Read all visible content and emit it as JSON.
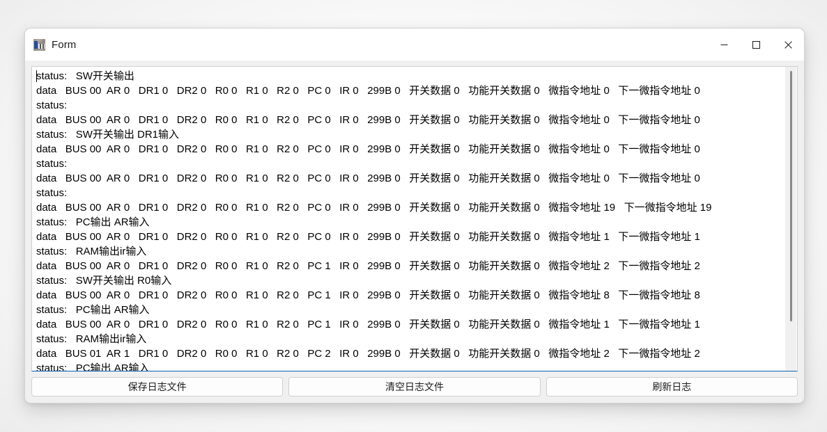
{
  "window": {
    "title": "Form",
    "icon": "app-form-icon",
    "controls": {
      "minimize": "─",
      "maximize": "□",
      "close": "✕"
    }
  },
  "log": {
    "lines": [
      "status:   SW开关输出",
      "data   BUS 00  AR 0   DR1 0   DR2 0   R0 0   R1 0   R2 0   PC 0   IR 0   299B 0   开关数据 0   功能开关数据 0   微指令地址 0   下一微指令地址 0",
      "status:",
      "data   BUS 00  AR 0   DR1 0   DR2 0   R0 0   R1 0   R2 0   PC 0   IR 0   299B 0   开关数据 0   功能开关数据 0   微指令地址 0   下一微指令地址 0",
      "status:   SW开关输出 DR1输入",
      "data   BUS 00  AR 0   DR1 0   DR2 0   R0 0   R1 0   R2 0   PC 0   IR 0   299B 0   开关数据 0   功能开关数据 0   微指令地址 0   下一微指令地址 0",
      "status:",
      "data   BUS 00  AR 0   DR1 0   DR2 0   R0 0   R1 0   R2 0   PC 0   IR 0   299B 0   开关数据 0   功能开关数据 0   微指令地址 0   下一微指令地址 0",
      "status:",
      "data   BUS 00  AR 0   DR1 0   DR2 0   R0 0   R1 0   R2 0   PC 0   IR 0   299B 0   开关数据 0   功能开关数据 0   微指令地址 19   下一微指令地址 19",
      "status:   PC输出 AR输入",
      "data   BUS 00  AR 0   DR1 0   DR2 0   R0 0   R1 0   R2 0   PC 0   IR 0   299B 0   开关数据 0   功能开关数据 0   微指令地址 1   下一微指令地址 1",
      "status:   RAM输出ir输入",
      "data   BUS 00  AR 0   DR1 0   DR2 0   R0 0   R1 0   R2 0   PC 1   IR 0   299B 0   开关数据 0   功能开关数据 0   微指令地址 2   下一微指令地址 2",
      "status:   SW开关输出 R0输入",
      "data   BUS 00  AR 0   DR1 0   DR2 0   R0 0   R1 0   R2 0   PC 1   IR 0   299B 0   开关数据 0   功能开关数据 0   微指令地址 8   下一微指令地址 8",
      "status:   PC输出 AR输入",
      "data   BUS 00  AR 0   DR1 0   DR2 0   R0 0   R1 0   R2 0   PC 1   IR 0   299B 0   开关数据 0   功能开关数据 0   微指令地址 1   下一微指令地址 1",
      "status:   RAM输出ir输入",
      "data   BUS 01  AR 1   DR1 0   DR2 0   R0 0   R1 0   R2 0   PC 2   IR 0   299B 0   开关数据 0   功能开关数据 0   微指令地址 2   下一微指令地址 2",
      "status:   PC输出 AR输入"
    ]
  },
  "buttons": {
    "save_log": "保存日志文件",
    "clear_log": "清空日志文件",
    "refresh_log": "刷新日志"
  },
  "colors": {
    "focus_border": "#0a64b4",
    "window_bg": "#f0f0f0",
    "text": "#000000"
  }
}
